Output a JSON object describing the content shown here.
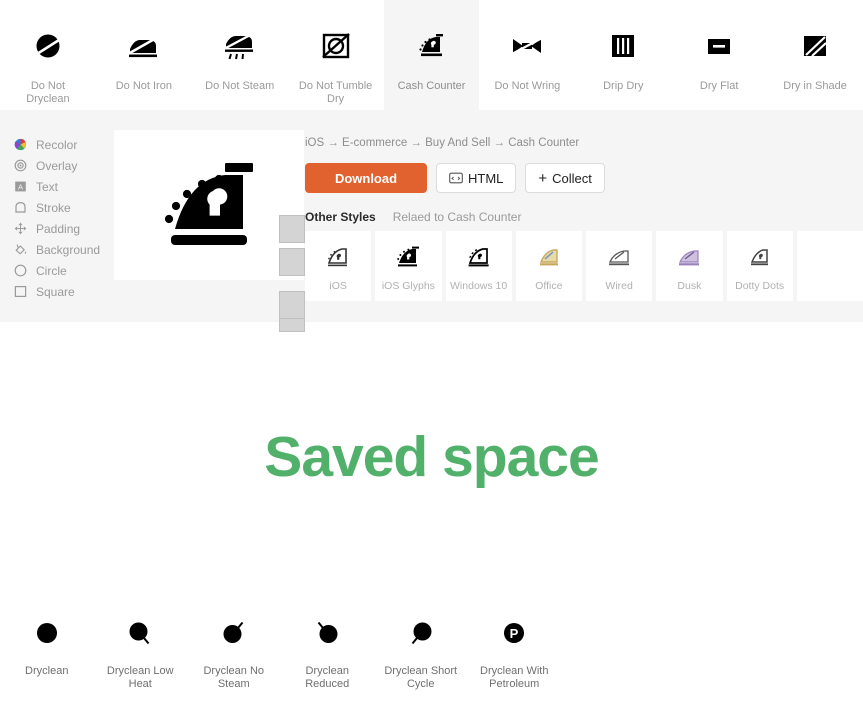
{
  "colors": {
    "accent_orange": "#e2622f",
    "saved_space_green": "#51b06a",
    "panel_bg": "#f5f5f5",
    "active_cell_bg": "#f5f5f5",
    "label_grey": "#9a9a9a",
    "placeholder_grey": "#d4d4d4"
  },
  "top_icon_row": [
    {
      "label": "Do Not Dryclean",
      "icon": "do-not-dryclean-icon",
      "active": false
    },
    {
      "label": "Do Not Iron",
      "icon": "do-not-iron-icon",
      "active": false
    },
    {
      "label": "Do Not Steam",
      "icon": "do-not-steam-icon",
      "active": false
    },
    {
      "label": "Do Not Tumble Dry",
      "icon": "do-not-tumble-dry-icon",
      "active": false
    },
    {
      "label": "Cash Counter",
      "icon": "cash-counter-icon",
      "active": true
    },
    {
      "label": "Do Not Wring",
      "icon": "do-not-wring-icon",
      "active": false
    },
    {
      "label": "Drip Dry",
      "icon": "drip-dry-icon",
      "active": false
    },
    {
      "label": "Dry Flat",
      "icon": "dry-flat-icon",
      "active": false
    },
    {
      "label": "Dry in Shade",
      "icon": "dry-in-shade-icon",
      "active": false
    }
  ],
  "sidebar": {
    "items": [
      {
        "label": "Recolor",
        "icon": "color-wheel-icon"
      },
      {
        "label": "Overlay",
        "icon": "overlay-target-icon"
      },
      {
        "label": "Text",
        "icon": "text-box-icon"
      },
      {
        "label": "Stroke",
        "icon": "stroke-shape-icon"
      },
      {
        "label": "Padding",
        "icon": "move-arrows-icon"
      },
      {
        "label": "Background",
        "icon": "paint-bucket-icon"
      },
      {
        "label": "Circle",
        "icon": "circle-icon"
      },
      {
        "label": "Square",
        "icon": "square-icon"
      }
    ]
  },
  "preview": {
    "icon": "cash-counter-large-icon"
  },
  "detail": {
    "breadcrumb": "iOS → E-commerce → Buy And Sell → Cash Counter",
    "buttons": {
      "download": "Download",
      "html": "HTML",
      "html_icon": "code-window-icon",
      "collect": "Collect",
      "collect_plus": "+"
    },
    "other_styles_title": "Other Styles",
    "other_styles_subtitle": "Relaed to Cash Counter",
    "styles": [
      {
        "label": "iOS",
        "icon": "style-ios-icon"
      },
      {
        "label": "iOS Glyphs",
        "icon": "style-ios-glyphs-icon"
      },
      {
        "label": "Windows 10",
        "icon": "style-windows10-icon"
      },
      {
        "label": "Office",
        "icon": "style-office-icon"
      },
      {
        "label": "Wired",
        "icon": "style-wired-icon"
      },
      {
        "label": "Dusk",
        "icon": "style-dusk-icon"
      },
      {
        "label": "Dotty Dots",
        "icon": "style-dotty-dots-icon"
      },
      {
        "label": "",
        "icon": "style-empty-icon"
      }
    ]
  },
  "saved_space_text": "Saved space",
  "bottom_icon_row": [
    {
      "label": "Dryclean",
      "icon": "dryclean-icon"
    },
    {
      "label": "Dryclean Low Heat",
      "icon": "dryclean-low-heat-icon"
    },
    {
      "label": "Dryclean No Steam",
      "icon": "dryclean-no-steam-icon"
    },
    {
      "label": "Dryclean Reduced",
      "icon": "dryclean-reduced-icon"
    },
    {
      "label": "Dryclean Short Cycle",
      "icon": "dryclean-short-cycle-icon"
    },
    {
      "label": "Dryclean With Petroleum",
      "icon": "dryclean-with-petroleum-icon"
    }
  ]
}
